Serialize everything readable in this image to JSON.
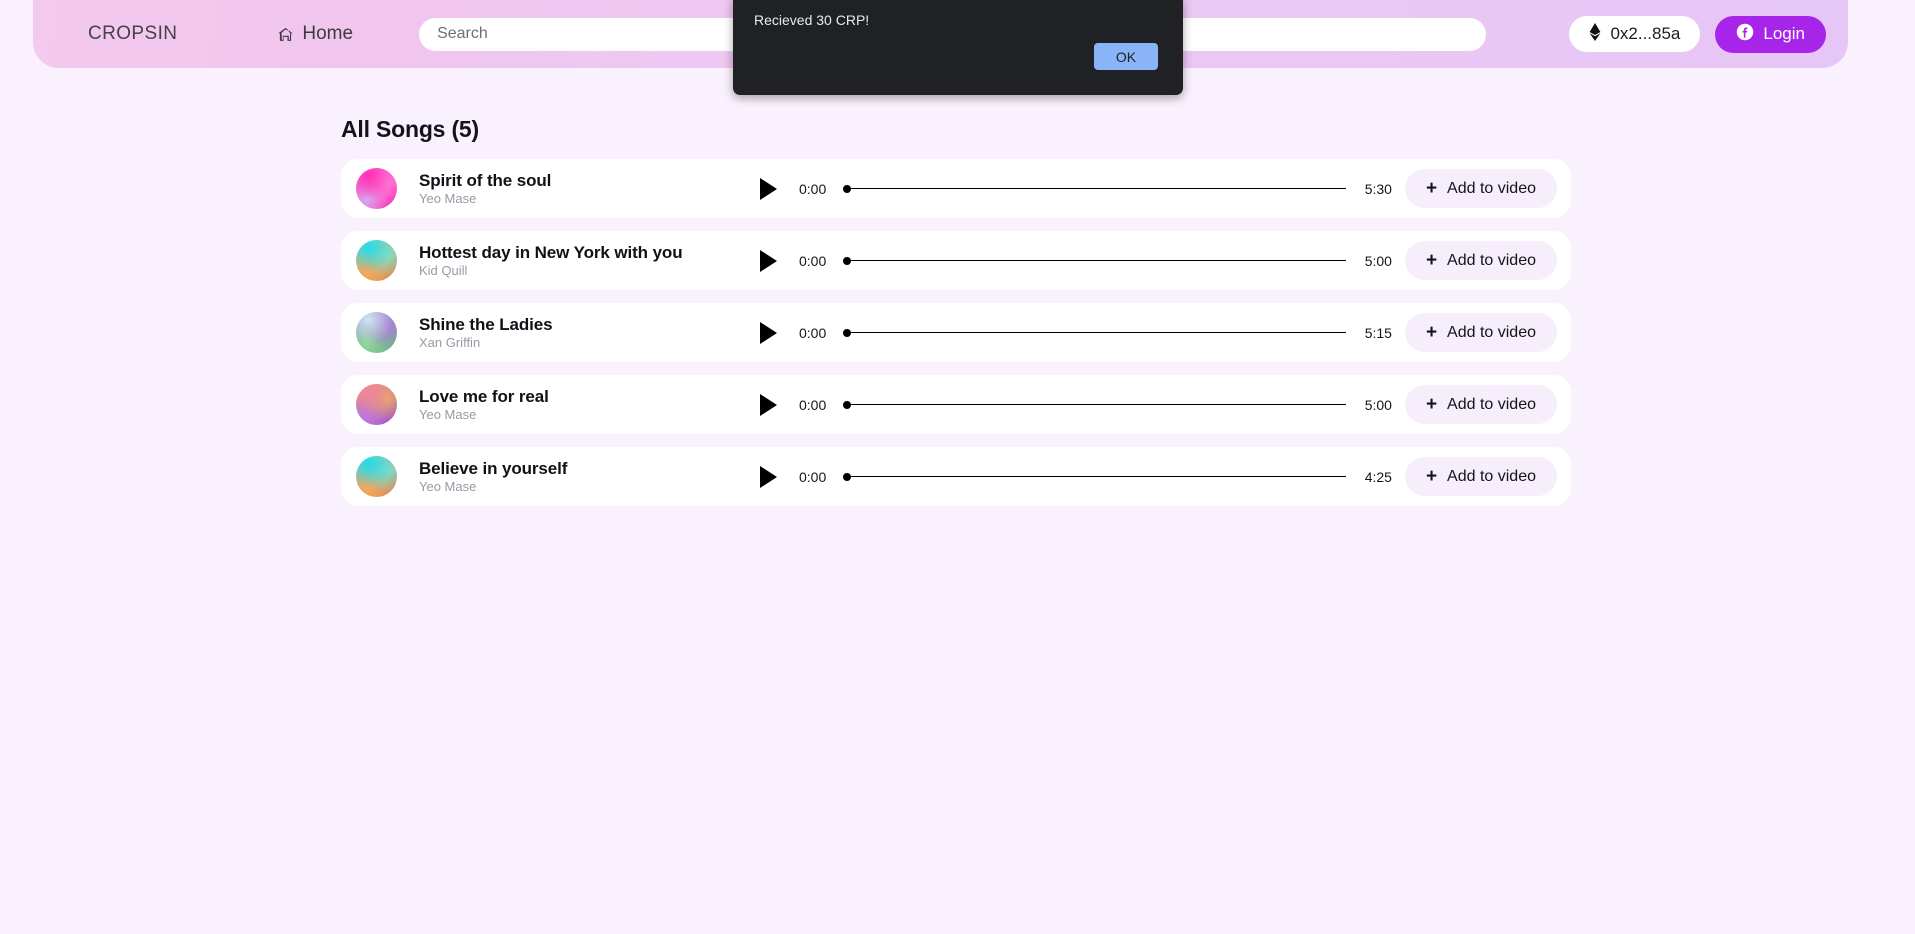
{
  "header": {
    "brand": "CROPSIN",
    "home_label": "Home",
    "home_icon": "house-icon",
    "search": {
      "value": "",
      "placeholder": "Search"
    },
    "wallet": {
      "icon": "ethereum-icon",
      "label": "0x2...85a"
    },
    "login": {
      "icon": "facebook-icon",
      "label": "Login"
    },
    "accent_color": "#a625e8",
    "gradient_from": "#f3c9ee",
    "gradient_to": "#e6c6f6"
  },
  "main": {
    "section_title": "All Songs (5)",
    "add_label": "Add to video",
    "add_icon": "plus-icon",
    "play_icon": "play-icon",
    "songs": [
      {
        "title": "Spirit of the soul",
        "artist": "Yeo Mase",
        "current_time": "0:00",
        "duration": "5:30",
        "progress_percent": 0,
        "thumb_colors": [
          "#ff2fb4",
          "#ff7ad9",
          "#d5a8f0",
          "#ff1fa8"
        ]
      },
      {
        "title": "Hottest day in New York with you",
        "artist": "Kid Quill",
        "current_time": "0:00",
        "duration": "5:00",
        "progress_percent": 0,
        "thumb_colors": [
          "#25dbe8",
          "#7fe3c8",
          "#f7a85c",
          "#f4793a"
        ]
      },
      {
        "title": "Shine the Ladies",
        "artist": "Xan Griffin",
        "current_time": "0:00",
        "duration": "5:15",
        "progress_percent": 0,
        "thumb_colors": [
          "#cfe6f5",
          "#b07fd8",
          "#8fd99a",
          "#58c07a"
        ]
      },
      {
        "title": "Love me for real",
        "artist": "Yeo Mase",
        "current_time": "0:00",
        "duration": "5:00",
        "progress_percent": 0,
        "thumb_colors": [
          "#f2849b",
          "#e8a86a",
          "#c07ae0",
          "#9b3fd8"
        ]
      },
      {
        "title": "Believe in yourself",
        "artist": "Yeo Mase",
        "current_time": "0:00",
        "duration": "4:25",
        "progress_percent": 0,
        "thumb_colors": [
          "#25dbe8",
          "#74e0d0",
          "#f7a85c",
          "#f4793a"
        ]
      }
    ]
  },
  "dialog": {
    "message": "Recieved 30 CRP!",
    "ok_label": "OK"
  }
}
